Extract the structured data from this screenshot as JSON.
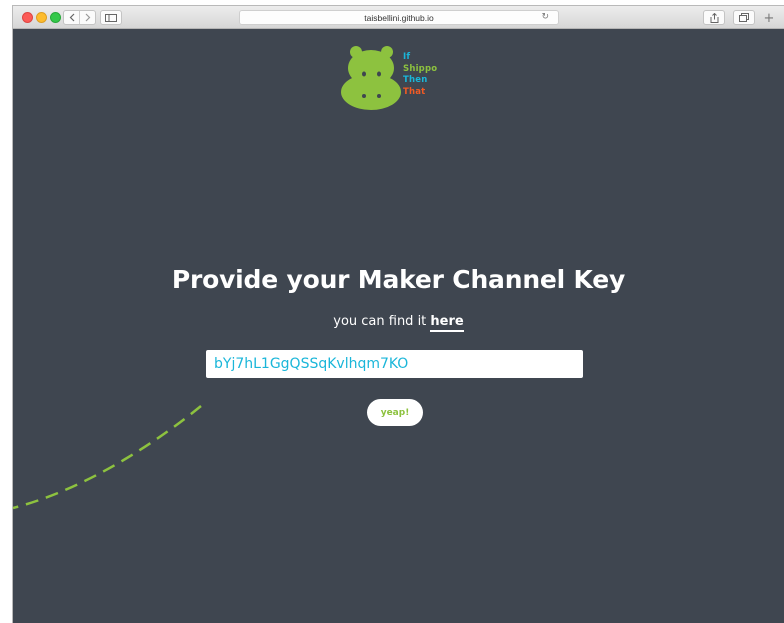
{
  "browser": {
    "url": "taisbellini.github.io",
    "icons": {
      "back": "chevron-left-icon",
      "forward": "chevron-right-icon",
      "sidebar": "sidebar-icon",
      "reload": "reload-icon",
      "share": "share-icon",
      "tabs": "tabs-icon",
      "new_tab": "plus-icon"
    }
  },
  "logo": {
    "line1": "If",
    "line2": "Shippo",
    "line3": "Then",
    "line4": "That",
    "colors": {
      "hippo": "#8dc23f",
      "line1": "#1ab6d9",
      "line2": "#8dc23f",
      "line3": "#1ab6d9",
      "line4": "#f15a24"
    }
  },
  "main": {
    "heading": "Provide your Maker Channel Key",
    "subtitle_prefix": "you can find it ",
    "subtitle_link": "here",
    "key_value": "bYj7hL1GgQSSqKvlhqm7KO",
    "submit_label": "yeap!"
  },
  "colors": {
    "background": "#3f4650",
    "accent_green": "#8dc23f",
    "accent_blue": "#1ab6d9"
  }
}
